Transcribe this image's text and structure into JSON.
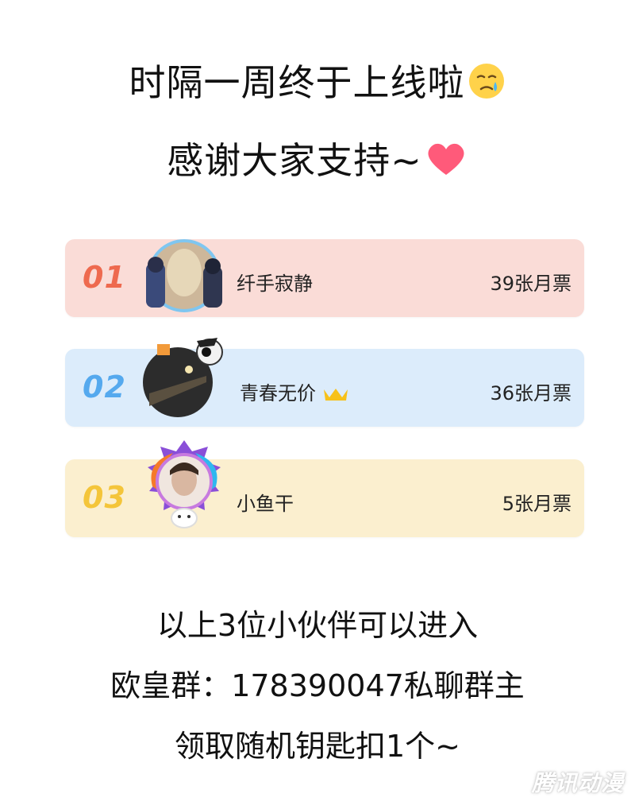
{
  "header": {
    "line1": "时隔一周终于上线啦",
    "line2": "感谢大家支持~"
  },
  "ranking": [
    {
      "rank": "01",
      "name": "纤手寂静",
      "votes": "39张月票",
      "color": "#fadcd7",
      "rank_color": "#ee6a4f"
    },
    {
      "rank": "02",
      "name": "青春无价",
      "votes": "36张月票",
      "color": "#dcecfb",
      "rank_color": "#55a9ee"
    },
    {
      "rank": "03",
      "name": "小鱼干",
      "votes": "5张月票",
      "color": "#fbefcf",
      "rank_color": "#f4c53a"
    }
  ],
  "footer": {
    "line1": "以上3位小伙伴可以进入",
    "line2": "欧皇群：178390047私聊群主",
    "line3": "领取随机钥匙扣1个~"
  },
  "watermark": "腾讯动漫",
  "icons": {
    "crying_face": "crying-face-emoji",
    "heart": "heart-emoji",
    "crown_badge": "yellow-crown-badge"
  }
}
